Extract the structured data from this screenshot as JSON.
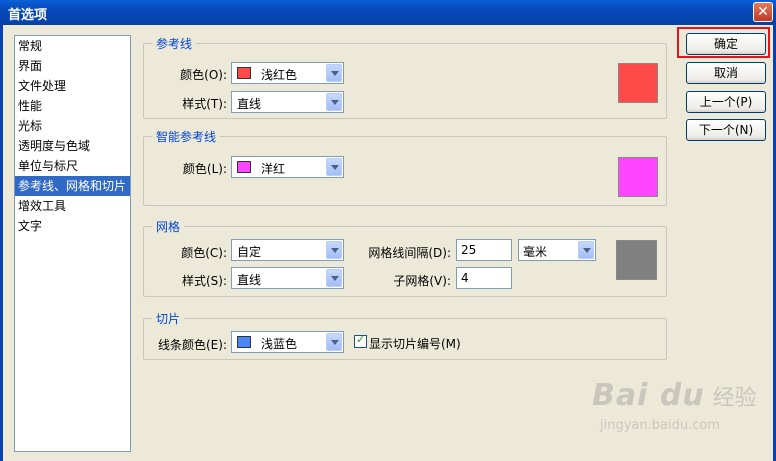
{
  "window": {
    "title": "首选项"
  },
  "sidebar": {
    "items": [
      {
        "label": "常规",
        "selected": false
      },
      {
        "label": "界面",
        "selected": false
      },
      {
        "label": "文件处理",
        "selected": false
      },
      {
        "label": "性能",
        "selected": false
      },
      {
        "label": "光标",
        "selected": false
      },
      {
        "label": "透明度与色域",
        "selected": false
      },
      {
        "label": "单位与标尺",
        "selected": false
      },
      {
        "label": "参考线、网格和切片",
        "selected": true
      },
      {
        "label": "增效工具",
        "selected": false
      },
      {
        "label": "文字",
        "selected": false
      }
    ]
  },
  "guides": {
    "title": "参考线",
    "color_label": "颜色(O):",
    "color_value": "浅红色",
    "color_hex": "#ff4a4a",
    "style_label": "样式(T):",
    "style_value": "直线"
  },
  "smart_guides": {
    "title": "智能参考线",
    "color_label": "颜色(L):",
    "color_value": "洋红",
    "color_hex": "#ff45ff"
  },
  "grid": {
    "title": "网格",
    "color_label": "颜色(C):",
    "color_value": "自定",
    "color_hex": "#808080",
    "style_label": "样式(S):",
    "style_value": "直线",
    "gridline_label": "网格线间隔(D):",
    "gridline_value": "25",
    "unit_value": "毫米",
    "subdivisions_label": "子网格(V):",
    "subdivisions_value": "4"
  },
  "slices": {
    "title": "切片",
    "line_color_label": "线条颜色(E):",
    "line_color_value": "浅蓝色",
    "line_color_hex": "#4a86f5",
    "show_numbers_label": "显示切片编号(M)",
    "show_numbers_checked": true
  },
  "buttons": {
    "ok": "确定",
    "cancel": "取消",
    "prev": "上一个(P)",
    "next": "下一个(N)"
  },
  "watermark": {
    "logo": "Bai du",
    "text": "经验",
    "url": "jingyan.baidu.com"
  }
}
